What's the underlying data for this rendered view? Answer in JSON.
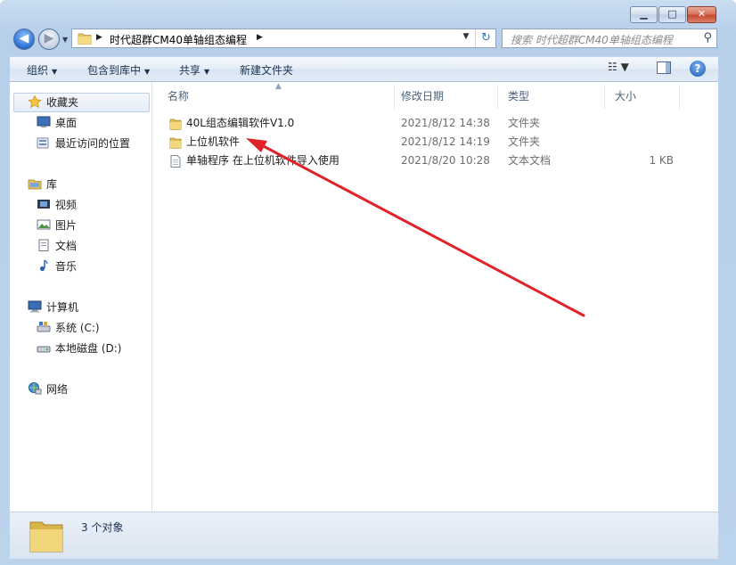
{
  "window": {
    "minimize_glyph": "▁",
    "maximize_glyph": "□",
    "close_glyph": "✕"
  },
  "navigation": {
    "back_glyph": "◀",
    "forward_glyph": "▶",
    "history_glyph": "▼"
  },
  "address_bar": {
    "separator": "▶",
    "path": "时代超群CM40单轴组态编程",
    "dropdown_glyph": "▼",
    "refresh_glyph": "↻"
  },
  "search": {
    "placeholder": "搜索 时代超群CM40单轴组态编程",
    "icon_glyph": "⚲"
  },
  "toolbar": {
    "organize": "组织",
    "include_in_library": "包含到库中",
    "share": "共享",
    "new_folder": "新建文件夹",
    "menu_arrow": "▼",
    "view_glyph": "☷ ▼",
    "help_glyph": "?"
  },
  "sidebar": {
    "favorites": "收藏夹",
    "desktop": "桌面",
    "recent_places": "最近访问的位置",
    "libraries": "库",
    "videos": "视频",
    "pictures": "图片",
    "documents": "文档",
    "music": "音乐",
    "computer": "计算机",
    "drive_c": "系统 (C:)",
    "drive_d": "本地磁盘 (D:)",
    "network": "网络"
  },
  "columns": {
    "name": "名称",
    "date_modified": "修改日期",
    "type": "类型",
    "size": "大小",
    "sort_indicator": "▲"
  },
  "files": [
    {
      "name": "40L组态编辑软件V1.0",
      "date": "2021/8/12 14:38",
      "type": "文件夹",
      "size": ""
    },
    {
      "name": "上位机软件",
      "date": "2021/8/12 14:19",
      "type": "文件夹",
      "size": ""
    },
    {
      "name": "单轴程序 在上位机软件导入使用",
      "date": "2021/8/20 10:28",
      "type": "文本文档",
      "size": "1 KB"
    }
  ],
  "status_bar": {
    "item_count": "3 个对象"
  },
  "annotation": {
    "arrow_color": "#e0232b"
  }
}
